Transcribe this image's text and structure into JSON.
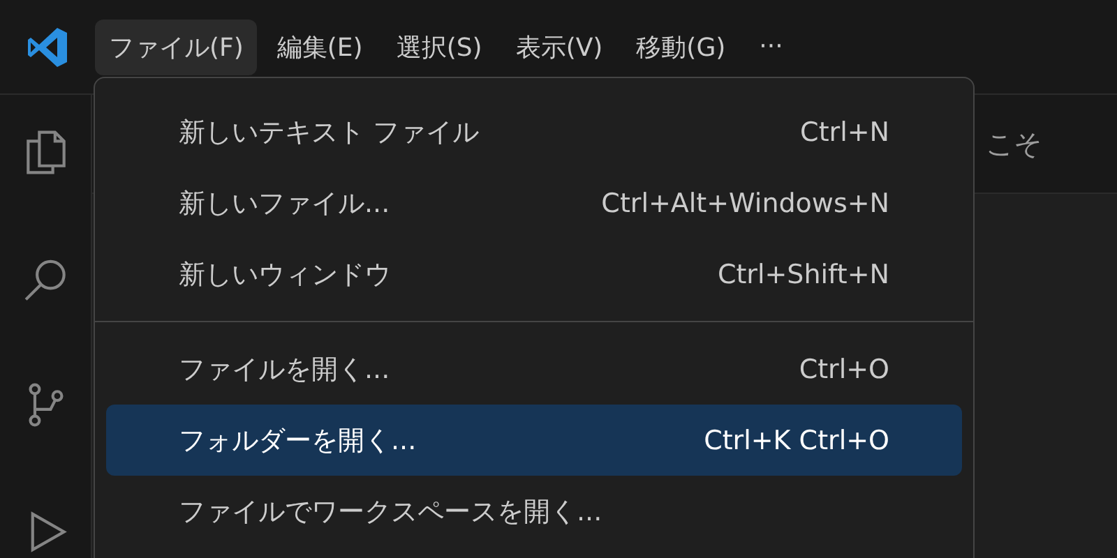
{
  "menubar": [
    {
      "label": "ファイル(F)",
      "selected": true
    },
    {
      "label": "編集(E)",
      "selected": false
    },
    {
      "label": "選択(S)",
      "selected": false
    },
    {
      "label": "表示(V)",
      "selected": false
    },
    {
      "label": "移動(G)",
      "selected": false
    },
    {
      "label": "···",
      "selected": false
    }
  ],
  "editor": {
    "tab_label": "こそ"
  },
  "menu": [
    {
      "kind": "item",
      "label": "新しいテキスト ファイル",
      "shortcut": "Ctrl+N",
      "selected": false
    },
    {
      "kind": "item",
      "label": "新しいファイル...",
      "shortcut": "Ctrl+Alt+Windows+N",
      "selected": false
    },
    {
      "kind": "item",
      "label": "新しいウィンドウ",
      "shortcut": "Ctrl+Shift+N",
      "selected": false
    },
    {
      "kind": "separator"
    },
    {
      "kind": "item",
      "label": "ファイルを開く...",
      "shortcut": "Ctrl+O",
      "selected": false
    },
    {
      "kind": "item",
      "label": "フォルダーを開く...",
      "shortcut": "Ctrl+K Ctrl+O",
      "selected": true
    },
    {
      "kind": "item",
      "label": "ファイルでワークスペースを開く...",
      "selected": false
    }
  ]
}
